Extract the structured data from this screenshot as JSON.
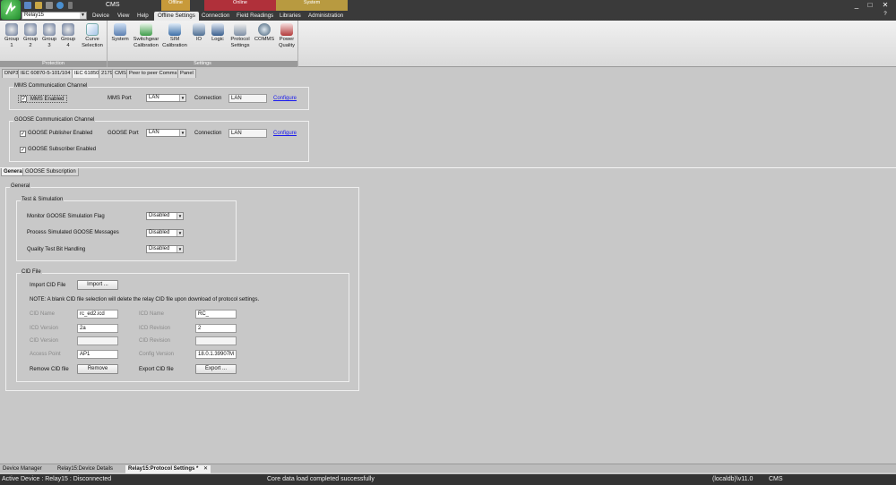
{
  "titlebar": {
    "app_title": "CMS",
    "context_tabs": [
      {
        "label": "Offline",
        "color": "#c89a3a"
      },
      {
        "label": "Online",
        "color": "#b0303a"
      },
      {
        "label": "System",
        "color": "#b89a40"
      }
    ],
    "window_buttons": [
      "_",
      "□",
      "✕"
    ]
  },
  "device_select": {
    "value": "Relay15"
  },
  "menu": {
    "items": [
      "Device",
      "View",
      "Help",
      "Offline Settings",
      "Connection",
      "Field Readings",
      "Libraries",
      "Administration"
    ],
    "active": "Offline Settings"
  },
  "ribbon": {
    "groups": [
      {
        "label": "Protection",
        "buttons": [
          "Group 1",
          "Group 2",
          "Group 3",
          "Group 4",
          "Curve Selection"
        ]
      },
      {
        "label": "Settings",
        "buttons": [
          "System",
          "Switchgear Calibration",
          "SIM Calibration",
          "IO",
          "Logic",
          "Protocol Settings",
          "COMMS",
          "Power Quality"
        ]
      }
    ]
  },
  "protocol_tabs": [
    "DNP3",
    "IEC 60870-5-101/104",
    "IEC 61850",
    "2179",
    "CMS",
    "Peer to peer Comms",
    "Panel"
  ],
  "protocol_tabs_active": "IEC 61850",
  "mms": {
    "group_title": "MMS Communication Channel",
    "enabled_label": "MMS Enabled",
    "port_label": "MMS Port",
    "port_value": "LAN",
    "connection_label": "Connection",
    "connection_value": "LAN",
    "configure": "Configure"
  },
  "goose": {
    "group_title": "GOOSE Communication Channel",
    "publisher_label": "GOOSE Publisher Enabled",
    "subscriber_label": "GOOSE Subscriber Enabled",
    "port_label": "GOOSE Port",
    "port_value": "LAN",
    "connection_label": "Connection",
    "connection_value": "LAN",
    "configure": "Configure"
  },
  "sub_tabs": [
    "General",
    "GOOSE Subscription"
  ],
  "sub_tabs_active": "General",
  "general": {
    "title": "General",
    "test_sim": {
      "title": "Test & Simulation",
      "rows": [
        {
          "label": "Monitor GOOSE Simulation Flag",
          "value": "Disabled"
        },
        {
          "label": "Process Simulated GOOSE Messages",
          "value": "Disabled"
        },
        {
          "label": "Quality Test Bit Handling",
          "value": "Disabled"
        }
      ]
    },
    "cid": {
      "title": "CID File",
      "import_label": "Import CID File",
      "import_button": "Import ...",
      "note": "NOTE: A blank CID file selection will delete the relay CID file upon download of protocol settings.",
      "left_fields": [
        {
          "label": "CID Name",
          "value": "rc_ed2.icd"
        },
        {
          "label": "ICD Version",
          "value": "2a"
        },
        {
          "label": "CID Version",
          "value": ""
        },
        {
          "label": "Access Point",
          "value": "AP1"
        }
      ],
      "right_fields": [
        {
          "label": "ICD Name",
          "value": "RC_"
        },
        {
          "label": "ICD Revision",
          "value": "2"
        },
        {
          "label": "CID Revision",
          "value": ""
        },
        {
          "label": "Config Version",
          "value": "18.0.1.39907M"
        }
      ],
      "remove_label": "Remove CID file",
      "remove_button": "Remove",
      "export_label": "Export CID file",
      "export_button": "Export ..."
    }
  },
  "doc_tabs": [
    "Device Manager",
    "Relay15:Device Details",
    "Relay15:Protocol Settings *"
  ],
  "doc_tabs_active": "Relay15:Protocol Settings *",
  "status": {
    "device": "Active Device : Relay15 : Disconnected",
    "message": "Core data load completed successfully",
    "db": "(localdb)\\v11.0",
    "app": "CMS"
  }
}
